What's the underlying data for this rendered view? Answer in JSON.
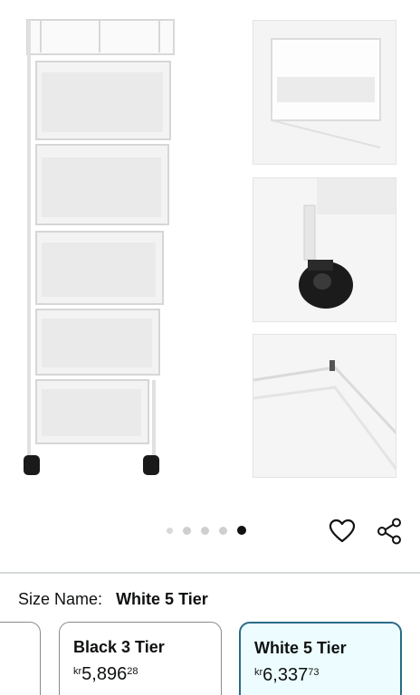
{
  "gallery": {
    "dots_count": 5,
    "active_dot_index": 4
  },
  "icons": {
    "wishlist": "heart-icon",
    "share": "share-icon"
  },
  "variation": {
    "label": "Size Name:",
    "selected": "White 5 Tier"
  },
  "options": [
    {
      "name": "Black 3 Tier",
      "currency": "kr",
      "whole": "5,896",
      "fraction": "28"
    },
    {
      "name": "White 5 Tier",
      "currency": "kr",
      "whole": "6,337",
      "fraction": "73"
    }
  ],
  "colors": {
    "selected_border": "#2b6a8a",
    "selected_bg": "#edfdff",
    "active_dot": "#111111"
  }
}
